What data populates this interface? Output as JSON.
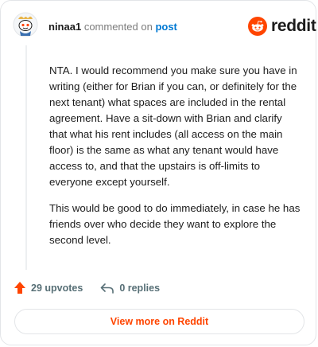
{
  "comment": {
    "username": "ninaa1",
    "verb": "commented on",
    "post_link": "post",
    "paragraphs": [
      "NTA. I would recommend you make sure you have in writing (either for Brian if you can, or definitely for the next tenant) what spaces are included in the rental agreement. Have a sit-down with Brian and clarify that what his rent includes (all access on the main floor) is the same as what any tenant would have access to, and that the upstairs is off-limits to everyone except yourself.",
      "This would be good to do immediately, in case he has friends over who decide they want to explore the second level."
    ]
  },
  "brand": {
    "name": "reddit",
    "logo_icon": "reddit-alien-icon",
    "color": "#ff4500"
  },
  "actions": {
    "upvotes_label": "29 upvotes",
    "upvote_icon": "upvote-arrow-icon",
    "replies_label": "0 replies",
    "reply_icon": "reply-arrow-icon"
  },
  "footer": {
    "view_more_label": "View more on Reddit"
  }
}
